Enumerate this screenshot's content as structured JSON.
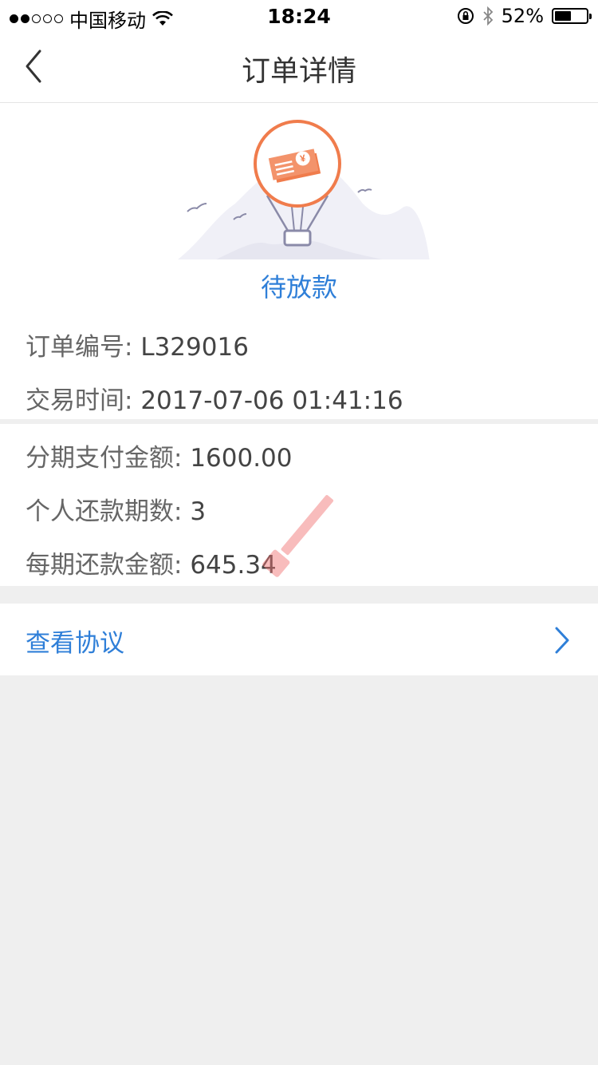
{
  "status_bar": {
    "carrier": "中国移动",
    "time": "18:24",
    "battery": "52%",
    "battery_level": 0.52
  },
  "nav": {
    "title": "订单详情",
    "back_icon": "chevron-left-icon"
  },
  "order": {
    "status": "待放款",
    "order_no_label": "订单编号:",
    "order_no": "L329016",
    "trade_time_label": "交易时间:",
    "trade_time": "2017-07-06 01:41:16"
  },
  "payment": {
    "amount_label": "分期支付金额:",
    "amount": "1600.00",
    "periods_label": "个人还款期数:",
    "periods": "3",
    "per_period_label": "每期还款金额:",
    "per_period": "645.34"
  },
  "agreement": {
    "label": "查看协议",
    "icon": "chevron-right-icon"
  },
  "colors": {
    "accent": "#2f7fd8",
    "illustration_orange": "#f07c4c",
    "background": "#efefef"
  }
}
